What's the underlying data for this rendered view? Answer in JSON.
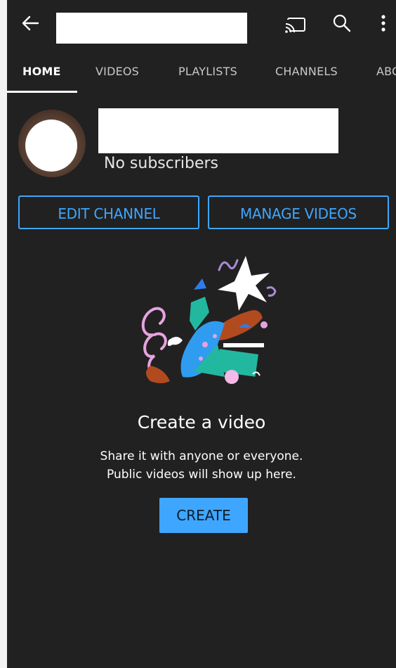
{
  "header": {
    "back_icon": "back-arrow-icon",
    "cast_icon": "cast-icon",
    "search_icon": "search-icon",
    "more_icon": "more-vertical-icon"
  },
  "tabs": [
    {
      "label": "HOME",
      "active": true
    },
    {
      "label": "VIDEOS"
    },
    {
      "label": "PLAYLISTS"
    },
    {
      "label": "CHANNELS"
    },
    {
      "label": "ABOUT"
    }
  ],
  "channel": {
    "subscribers": "No subscribers"
  },
  "actions": {
    "edit_label": "EDIT CHANNEL",
    "manage_label": "MANAGE VIDEOS"
  },
  "empty_state": {
    "title": "Create a video",
    "line1": "Share it with anyone or everyone.",
    "line2": "Public videos will show up here.",
    "button_label": "CREATE"
  },
  "colors": {
    "background": "#212121",
    "accent": "#3ea6ff",
    "text": "#ffffff"
  }
}
